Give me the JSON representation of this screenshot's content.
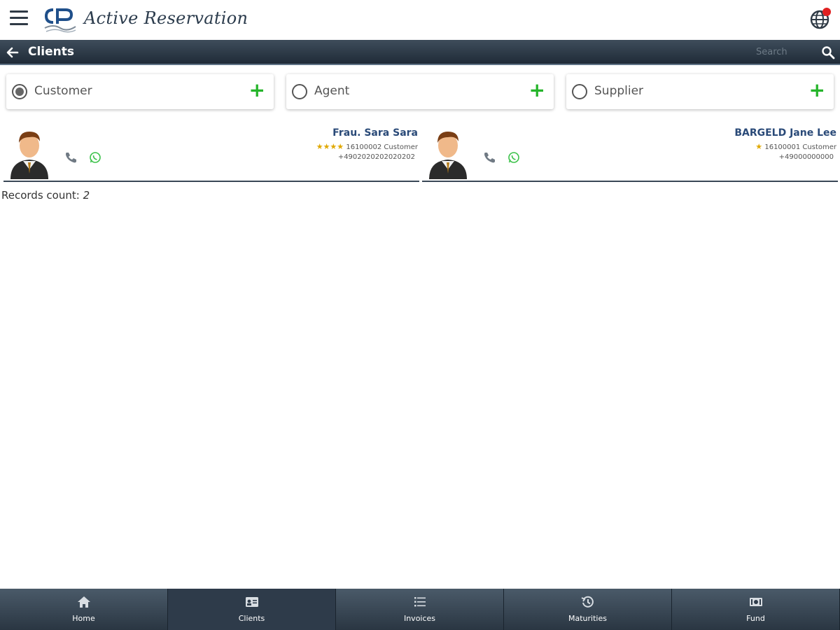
{
  "app": {
    "title": "Active Reservation"
  },
  "header": {
    "title": "Clients",
    "search_placeholder": "Search"
  },
  "filters": [
    {
      "label": "Customer",
      "selected": true
    },
    {
      "label": "Agent",
      "selected": false
    },
    {
      "label": "Supplier",
      "selected": false
    }
  ],
  "clients": [
    {
      "name": "Frau. Sara Sara",
      "stars": "★★★★",
      "id_type": "16100002 Customer",
      "phone": "+4902020202020202"
    },
    {
      "name": "BARGELD Jane Lee",
      "stars": "★",
      "id_type": "16100001 Customer",
      "phone": "+49000000000"
    }
  ],
  "records": {
    "label": "Records count:",
    "count": "2"
  },
  "nav": [
    {
      "label": "Home",
      "icon": "home-icon"
    },
    {
      "label": "Clients",
      "icon": "id-card-icon"
    },
    {
      "label": "Invoices",
      "icon": "list-icon"
    },
    {
      "label": "Maturities",
      "icon": "history-icon"
    },
    {
      "label": "Fund",
      "icon": "money-icon"
    }
  ],
  "colors": {
    "accent_green": "#25b42a",
    "bar_dark": "#1f2b37",
    "name_blue": "#2a4a78",
    "star_gold": "#e0a800"
  }
}
